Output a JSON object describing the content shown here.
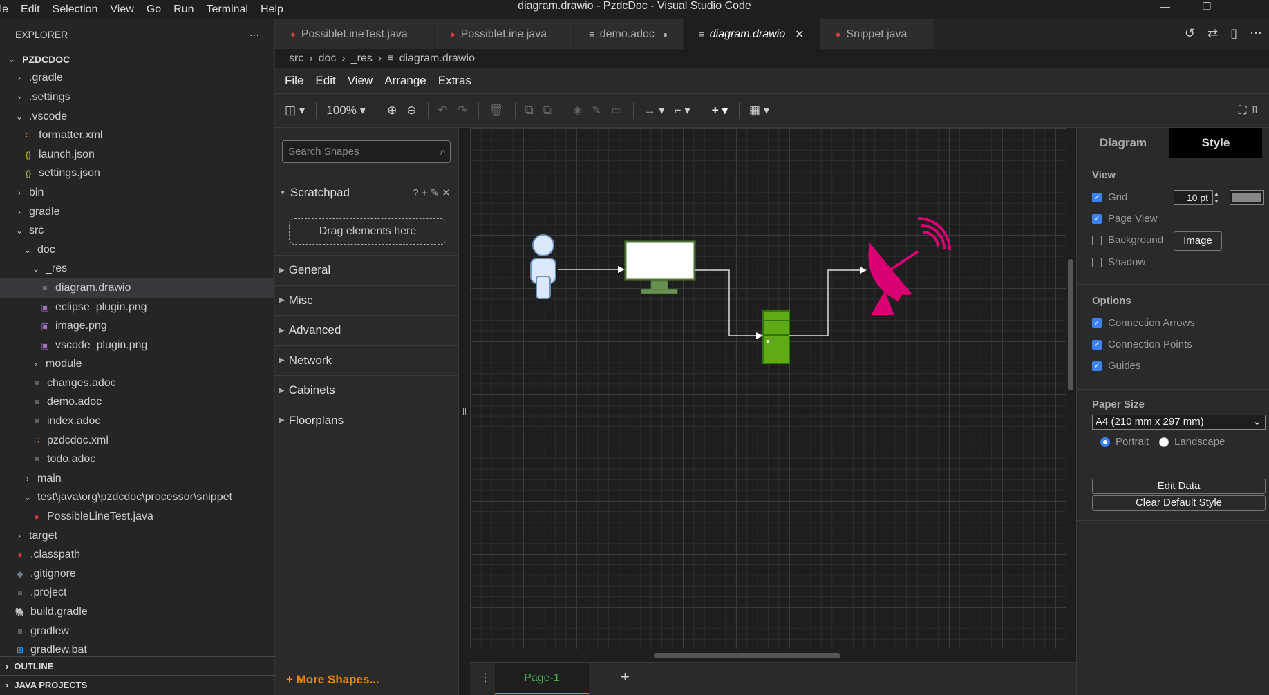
{
  "window": {
    "title": "diagram.drawio - PzdcDoc - Visual Studio Code",
    "menu": [
      "ile",
      "Edit",
      "Selection",
      "View",
      "Go",
      "Run",
      "Terminal",
      "Help"
    ]
  },
  "explorer": {
    "header": "EXPLORER",
    "more": "···",
    "tree": [
      {
        "label": "PZDCDOC",
        "icon": "chevron-down-icon",
        "indent": 0,
        "bold": true
      },
      {
        "label": ".gradle",
        "twisty": "›",
        "indent": 1
      },
      {
        "label": ".settings",
        "twisty": "›",
        "indent": 1
      },
      {
        "label": ".vscode",
        "twisty": "⌄",
        "indent": 1
      },
      {
        "label": "formatter.xml",
        "icon": "rss-icon",
        "indent": 2
      },
      {
        "label": "launch.json",
        "icon": "json-icon",
        "indent": 2
      },
      {
        "label": "settings.json",
        "icon": "json-icon",
        "indent": 2
      },
      {
        "label": "bin",
        "twisty": "›",
        "indent": 1
      },
      {
        "label": "gradle",
        "twisty": "›",
        "indent": 1
      },
      {
        "label": "src",
        "twisty": "⌄",
        "indent": 1
      },
      {
        "label": "doc",
        "twisty": "⌄",
        "indent": 2
      },
      {
        "label": "_res",
        "twisty": "⌄",
        "indent": 3
      },
      {
        "label": "diagram.drawio",
        "icon": "file-icon",
        "indent": 4,
        "selected": true
      },
      {
        "label": "eclipse_plugin.png",
        "icon": "image-icon",
        "indent": 4
      },
      {
        "label": "image.png",
        "icon": "image-icon",
        "indent": 4
      },
      {
        "label": "vscode_plugin.png",
        "icon": "image-icon",
        "indent": 4
      },
      {
        "label": "module",
        "twisty": "›",
        "indent": 3
      },
      {
        "label": "changes.adoc",
        "icon": "file-icon",
        "indent": 3
      },
      {
        "label": "demo.adoc",
        "icon": "file-icon",
        "indent": 3
      },
      {
        "label": "index.adoc",
        "icon": "file-icon",
        "indent": 3
      },
      {
        "label": "pzdcdoc.xml",
        "icon": "rss-icon",
        "indent": 3
      },
      {
        "label": "todo.adoc",
        "icon": "file-icon",
        "indent": 3
      },
      {
        "label": "main",
        "twisty": "›",
        "indent": 2
      },
      {
        "label": "test\\java\\org\\pzdcdoc\\processor\\snippet",
        "twisty": "⌄",
        "indent": 2
      },
      {
        "label": "PossibleLineTest.java",
        "icon": "java-icon",
        "indent": 3
      },
      {
        "label": "target",
        "twisty": "›",
        "indent": 1
      },
      {
        "label": ".classpath",
        "icon": "java-icon",
        "indent": 1
      },
      {
        "label": ".gitignore",
        "icon": "git-icon",
        "indent": 1
      },
      {
        "label": ".project",
        "icon": "file-icon",
        "indent": 1
      },
      {
        "label": "build.gradle",
        "icon": "gradle-icon",
        "indent": 1
      },
      {
        "label": "gradlew",
        "icon": "file-icon",
        "indent": 1
      },
      {
        "label": "gradlew.bat",
        "icon": "windows-icon",
        "indent": 1
      }
    ],
    "outline": "OUTLINE",
    "java_projects": "JAVA PROJECTS"
  },
  "tabs": [
    {
      "label": "PossibleLineTest.java",
      "icon": "java-icon"
    },
    {
      "label": "PossibleLine.java",
      "icon": "java-icon"
    },
    {
      "label": "demo.adoc",
      "icon": "file-icon",
      "modified": true
    },
    {
      "label": "diagram.drawio",
      "icon": "file-icon",
      "active": true
    },
    {
      "label": "Snippet.java",
      "icon": "java-icon"
    }
  ],
  "breadcrumb": [
    "src",
    "doc",
    "_res",
    "diagram.drawio"
  ],
  "drawio": {
    "menu": [
      "File",
      "Edit",
      "View",
      "Arrange",
      "Extras"
    ],
    "zoom": "100%",
    "search_placeholder": "Search Shapes",
    "scratchpad": "Scratchpad",
    "scratchpad_tools": "? + ✎ ✕",
    "drag_here": "Drag elements here",
    "libraries": [
      "General",
      "Misc",
      "Advanced",
      "Network",
      "Cabinets",
      "Floorplans"
    ],
    "more_shapes": "+ More Shapes...",
    "page_tab": "Page-1",
    "format": {
      "tab_diagram": "Diagram",
      "tab_style": "Style",
      "view_title": "View",
      "grid": "Grid",
      "grid_size": "10 pt",
      "page_view": "Page View",
      "background": "Background",
      "image_button": "Image",
      "shadow": "Shadow",
      "options_title": "Options",
      "connection_arrows": "Connection Arrows",
      "connection_points": "Connection Points",
      "guides": "Guides",
      "paper_size_title": "Paper Size",
      "paper_size": "A4 (210 mm x 297 mm)",
      "portrait": "Portrait",
      "landscape": "Landscape",
      "edit_data": "Edit Data",
      "clear_default_style": "Clear Default Style"
    }
  }
}
